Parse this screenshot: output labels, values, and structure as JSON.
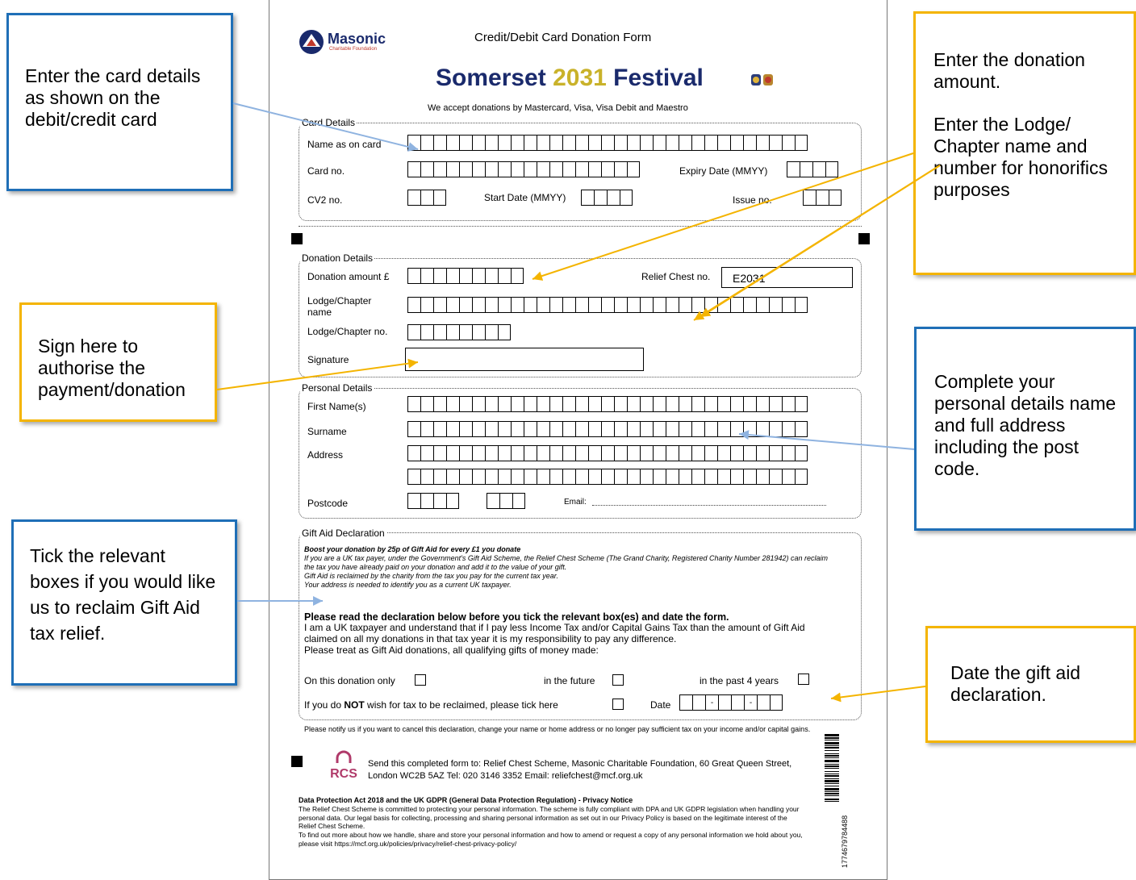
{
  "form": {
    "header_title": "Credit/Debit Card Donation Form",
    "logo_name": "Masonic",
    "logo_sub": "Charitable Foundation",
    "festival_part1": "Somerset",
    "festival_year": "2031",
    "festival_part2": "Festival",
    "accept_text": "We accept donations by Mastercard, Visa, Visa Debit and Maestro",
    "card": {
      "title": "Card Details",
      "name_label": "Name as on card",
      "cardno_label": "Card no.",
      "expiry_label": "Expiry Date (MMYY)",
      "cv2_label": "CV2 no.",
      "start_label": "Start Date (MMYY)",
      "issue_label": "Issue no."
    },
    "donation": {
      "title": "Donation Details",
      "amount_label": "Donation amount £",
      "chest_label": "Relief Chest no.",
      "chest_value": "E2031",
      "lodge_name_label": "Lodge/Chapter name",
      "lodge_no_label": "Lodge/Chapter no.",
      "signature_label": "Signature"
    },
    "personal": {
      "title": "Personal Details",
      "first_label": "First Name(s)",
      "surname_label": "Surname",
      "address_label": "Address",
      "postcode_label": "Postcode",
      "email_label": "Email:"
    },
    "giftaid": {
      "title": "Gift Aid Declaration",
      "boost": "Boost your donation by 25p of Gift Aid for every £1 you donate",
      "para1": "If you are a UK tax payer, under the Government's Gift Aid Scheme, the Relief Chest Scheme (The Grand Charity, Registered Charity Number 281942) can reclaim the tax you have already paid on your donation and add it to the value of your gift.",
      "para2": "Gift Aid is reclaimed by the charity from the tax you pay for the current tax year.",
      "para3": "Your address is needed to identify you as a current UK taxpayer.",
      "read_heading": "Please read the declaration below before you tick the relevant box(es) and date the form.",
      "declaration": "I am a UK taxpayer and understand that if I pay less Income Tax and/or Capital Gains Tax than the amount of Gift Aid claimed on all my donations in that tax year it is my responsibility to pay any difference.",
      "treat": "Please treat as Gift Aid donations, all qualifying gifts of money made:",
      "opt_this": "On this donation only",
      "opt_future": "in the future",
      "opt_past": "in the past 4 years",
      "not_prefix": "If you do ",
      "not_bold": "NOT",
      "not_suffix": " wish for tax to be reclaimed, please tick here",
      "date_label": "Date",
      "date_sep": "-"
    },
    "notify": "Please notify us if you want to cancel this declaration, change your name or home address or no longer pay sufficient tax on your income and/or capital gains.",
    "send": "Send this completed form to: Relief Chest Scheme, Masonic Charitable Foundation, 60 Great Queen Street, London WC2B 5AZ Tel: 020 3146 3352 Email: reliefchest@mcf.org.uk",
    "rcs_logo": "RCS",
    "barcode_number": "1774679784488",
    "privacy_title": "Data Protection Act 2018 and the UK GDPR (General Data Protection Regulation) - Privacy Notice",
    "privacy_body": "The Relief Chest Scheme is committed to protecting your personal information. The scheme is fully compliant with DPA and UK GDPR legislation when handling your personal data. Our legal basis for collecting, processing and sharing personal information as set out in our Privacy Policy is based on the legitimate interest of the Relief Chest Scheme.",
    "privacy_more": "To find out more about how we handle, share and store your personal information and how to amend or request a copy of any personal information we hold about you, please visit https://mcf.org.uk/policies/privacy/relief-chest-privacy-policy/"
  },
  "callouts": {
    "card": "Enter the card details as shown on the debit/credit card",
    "sign": "Sign here to authorise the payment/donation",
    "giftaid": "Tick the relevant boxes if you would like us to reclaim Gift Aid tax relief.",
    "donation_amount": "Enter the donation amount.",
    "lodge": "Enter the Lodge/ Chapter name and number for honorifics purposes",
    "personal": "Complete your personal details name and full address including the post code.",
    "date": "Date the gift aid declaration."
  },
  "colors": {
    "blue_border": "#1f6fb7",
    "yellow_border": "#f4b400",
    "navy": "#1a2a6c",
    "gold": "#c9b22a"
  }
}
